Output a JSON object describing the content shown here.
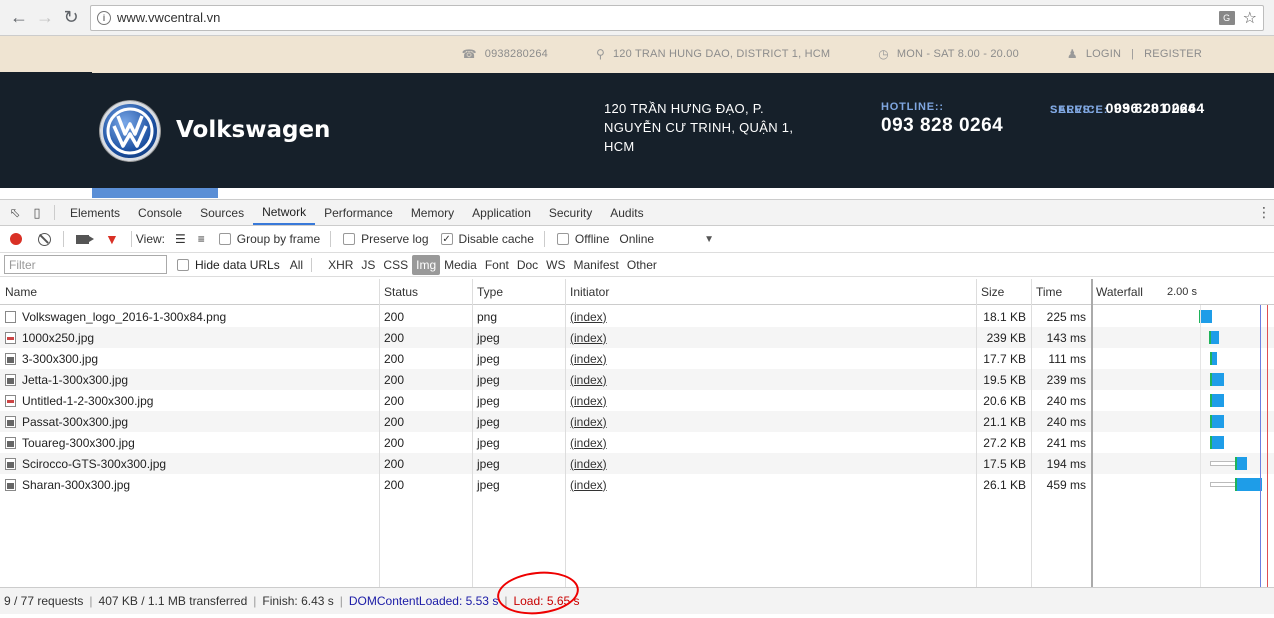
{
  "browser": {
    "url": "www.vwcentral.vn"
  },
  "topbar": {
    "phone": "0938280264",
    "address": "120 TRAN HUNG DAO, DISTRICT 1, HCM",
    "hours": "MON - SAT 8.00 - 20.00",
    "login": "LOGIN",
    "register": "REGISTER"
  },
  "header": {
    "brand": "Volkswagen",
    "address_l1": "120 TRẦN HƯNG ĐẠO, P.",
    "address_l2": "NGUYỄN CƯ TRINH, QUẬN 1,",
    "address_l3": "HCM",
    "hotline_label": "HOTLINE::",
    "hotline_number": "093 828 0264",
    "service_label": "SERVICE:",
    "service_number": "096 201 0264",
    "sales_label": "SALES::",
    "sales_number": "093 828 0264"
  },
  "devtools": {
    "tabs": [
      "Elements",
      "Console",
      "Sources",
      "Network",
      "Performance",
      "Memory",
      "Application",
      "Security",
      "Audits"
    ],
    "active_tab": "Network",
    "toolbar": {
      "view": "View:",
      "group_by_frame": "Group by frame",
      "preserve_log": "Preserve log",
      "disable_cache": "Disable cache",
      "offline": "Offline",
      "throttle": "Online"
    },
    "filter_placeholder": "Filter",
    "hide_data_urls": "Hide data URLs",
    "types": [
      "All",
      "XHR",
      "JS",
      "CSS",
      "Img",
      "Media",
      "Font",
      "Doc",
      "WS",
      "Manifest",
      "Other"
    ],
    "active_type": "Img",
    "columns": {
      "name": "Name",
      "status": "Status",
      "type": "Type",
      "initiator": "Initiator",
      "size": "Size",
      "time": "Time",
      "waterfall": "Waterfall",
      "waterfall_scale": "2.00 s"
    },
    "requests": [
      {
        "name": "Volkswagen_logo_2016-1-300x84.png",
        "status": "200",
        "type": "png",
        "initiator": "(index)",
        "size": "18.1 KB",
        "time": "225 ms"
      },
      {
        "name": "1000x250.jpg",
        "status": "200",
        "type": "jpeg",
        "initiator": "(index)",
        "size": "239 KB",
        "time": "143 ms"
      },
      {
        "name": "3-300x300.jpg",
        "status": "200",
        "type": "jpeg",
        "initiator": "(index)",
        "size": "17.7 KB",
        "time": "111 ms"
      },
      {
        "name": "Jetta-1-300x300.jpg",
        "status": "200",
        "type": "jpeg",
        "initiator": "(index)",
        "size": "19.5 KB",
        "time": "239 ms"
      },
      {
        "name": "Untitled-1-2-300x300.jpg",
        "status": "200",
        "type": "jpeg",
        "initiator": "(index)",
        "size": "20.6 KB",
        "time": "240 ms"
      },
      {
        "name": "Passat-300x300.jpg",
        "status": "200",
        "type": "jpeg",
        "initiator": "(index)",
        "size": "21.1 KB",
        "time": "240 ms"
      },
      {
        "name": "Touareg-300x300.jpg",
        "status": "200",
        "type": "jpeg",
        "initiator": "(index)",
        "size": "27.2 KB",
        "time": "241 ms"
      },
      {
        "name": "Scirocco-GTS-300x300.jpg",
        "status": "200",
        "type": "jpeg",
        "initiator": "(index)",
        "size": "17.5 KB",
        "time": "194 ms"
      },
      {
        "name": "Sharan-300x300.jpg",
        "status": "200",
        "type": "jpeg",
        "initiator": "(index)",
        "size": "26.1 KB",
        "time": "459 ms"
      }
    ],
    "statusbar": {
      "requests": "9 / 77 requests",
      "transferred": "407 KB / 1.1 MB transferred",
      "finish": "Finish: 6.43 s",
      "dcl": "DOMContentLoaded: 5.53 s",
      "load": "Load: 5.65 s"
    }
  }
}
